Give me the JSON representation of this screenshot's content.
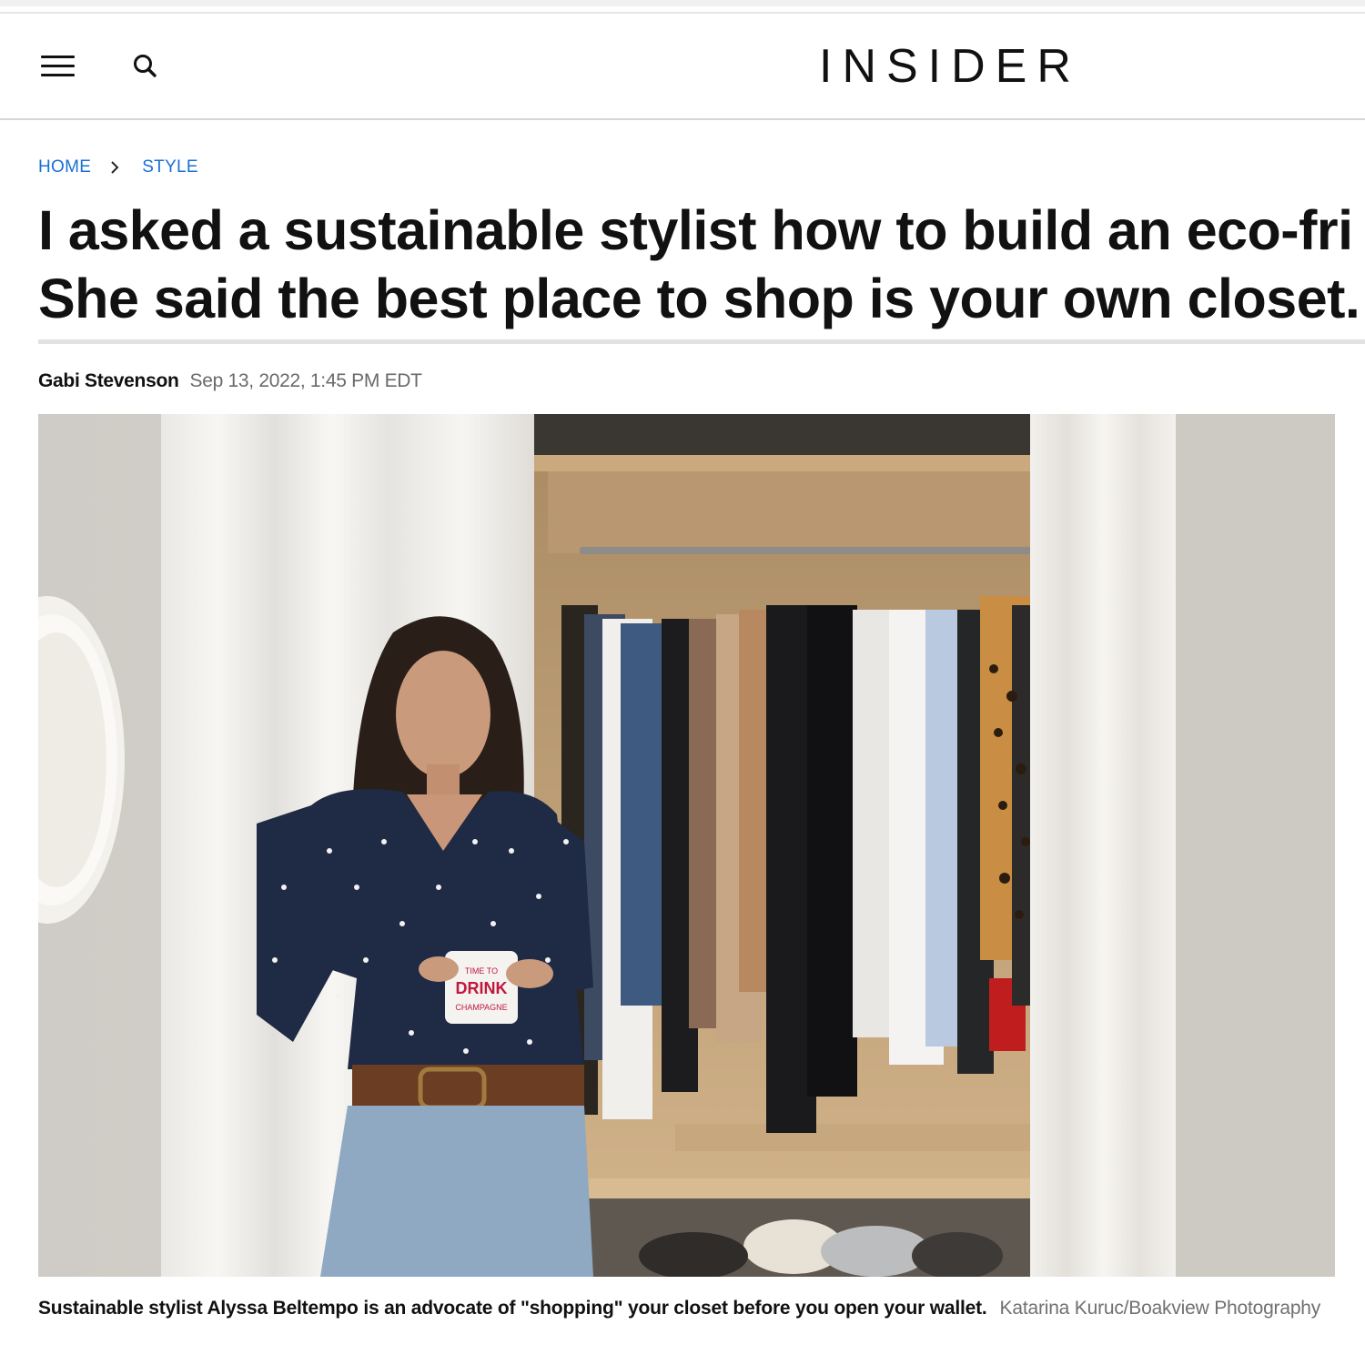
{
  "header": {
    "logo": "INSIDER",
    "menu_icon": "hamburger-menu-icon",
    "search_icon": "search-icon"
  },
  "breadcrumb": {
    "items": [
      {
        "label": "HOME"
      },
      {
        "label": "STYLE"
      }
    ],
    "separator_icon": "chevron-right-icon"
  },
  "article": {
    "headline_lines": [
      "I asked a sustainable stylist how to build an eco-fri",
      "She said the best place to shop is your own closet."
    ],
    "author": "Gabi Stevenson",
    "date": "Sep 13, 2022, 1:45 PM EDT",
    "image": {
      "mug_text": [
        "TIME TO",
        "DRINK",
        "CHAMPAGNE"
      ]
    },
    "caption": "Sustainable stylist Alyssa Beltempo is an advocate of \"shopping\" your closet before you open your wallet.",
    "credit": "Katarina Kuruc/Boakview Photography"
  },
  "colors": {
    "link": "#1a6fd6",
    "text": "#111111",
    "muted": "#6a6a6a",
    "rule": "#e2e2e2"
  }
}
